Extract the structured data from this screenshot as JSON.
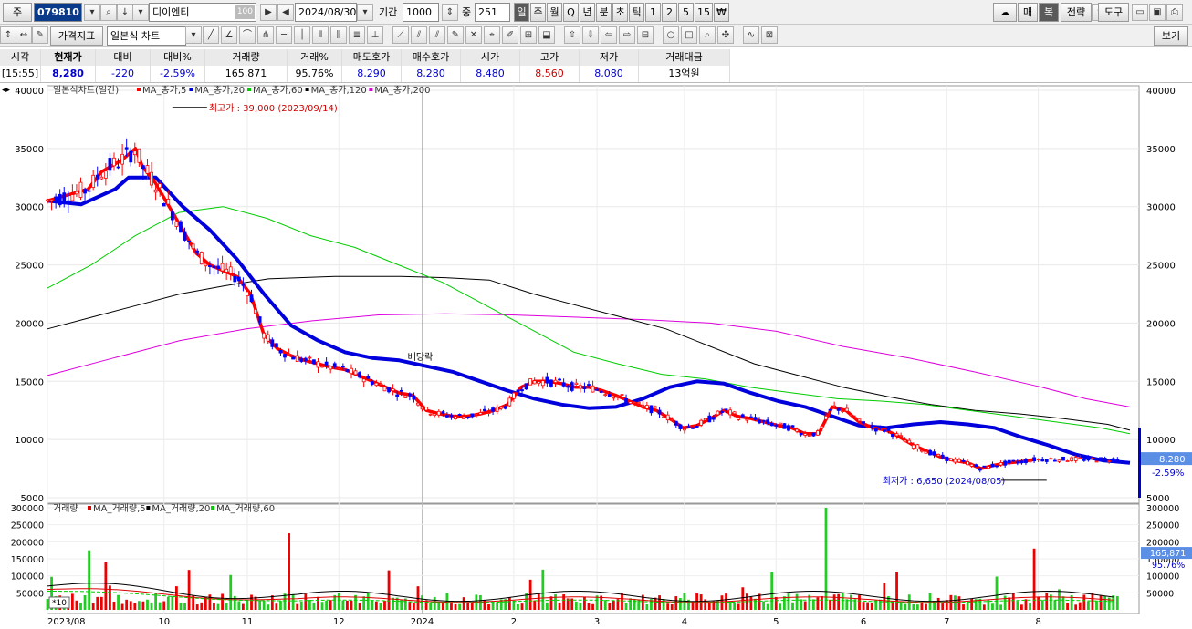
{
  "toolbar": {
    "mode_label": "주",
    "code": "079810",
    "name": "디이엔티",
    "name_badge": "100",
    "date": "2024/08/30",
    "period_label": "기간",
    "period_value": "1000",
    "mid_label": "중",
    "mid_value": "251",
    "timeframes": [
      "일",
      "주",
      "월",
      "Q",
      "년",
      "분",
      "초",
      "틱",
      "1",
      "2",
      "5",
      "15",
      "₩"
    ],
    "selected_timeframe": "일",
    "right_buttons": [
      "매",
      "복",
      "전략",
      "도구"
    ],
    "indicator_button": "가격지표",
    "chart_type": "일본식 차트",
    "view_button": "보기"
  },
  "quote": {
    "headers": [
      "시각",
      "현재가",
      "대비",
      "대비%",
      "거래량",
      "거래%",
      "매도호가",
      "매수호가",
      "시가",
      "고가",
      "저가",
      "거래대금"
    ],
    "values": [
      "[15:55]",
      "8,280",
      "-220",
      "-2.59%",
      "165,871",
      "95.76%",
      "8,290",
      "8,280",
      "8,480",
      "8,560",
      "8,080",
      "13억원"
    ]
  },
  "colors": {
    "ma5": "#ff0000",
    "ma20": "#0000dd",
    "ma60": "#00cc00",
    "ma120": "#000000",
    "ma200": "#dd00dd",
    "candle_up": "#ff0000",
    "candle_down": "#0000ff"
  },
  "chart_data": [
    {
      "type": "line",
      "legend_title": "일본식차트(일간)",
      "legend": [
        "MA_종가,5",
        "MA_종가,20",
        "MA_종가,60",
        "MA_종가,120",
        "MA_종가,200"
      ],
      "ylim": [
        5000,
        40000
      ],
      "yticks": [
        40000,
        35000,
        30000,
        25000,
        20000,
        15000,
        10000,
        5000
      ],
      "x_labels": [
        "2023/08",
        "10",
        "11",
        "12",
        "2024",
        "2",
        "3",
        "4",
        "5",
        "6",
        "7",
        "8"
      ],
      "x_label_index": [
        0,
        28,
        48,
        70,
        90,
        112,
        132,
        153,
        175,
        196,
        216,
        238
      ],
      "n_days": 260,
      "series": [
        {
          "name": "MA_종가,5",
          "values": [
            [
              0,
              30500
            ],
            [
              6,
              31000
            ],
            [
              12,
              31500
            ],
            [
              16,
              33000
            ],
            [
              22,
              34000
            ],
            [
              26,
              35000
            ],
            [
              28,
              33500
            ],
            [
              32,
              32000
            ],
            [
              36,
              30000
            ],
            [
              40,
              28000
            ],
            [
              44,
              26000
            ],
            [
              48,
              25000
            ],
            [
              52,
              24500
            ],
            [
              56,
              24000
            ],
            [
              60,
              22500
            ],
            [
              64,
              19000
            ],
            [
              68,
              17800
            ],
            [
              72,
              17200
            ],
            [
              76,
              16800
            ],
            [
              80,
              16500
            ],
            [
              84,
              16200
            ],
            [
              88,
              16000
            ],
            [
              92,
              15500
            ],
            [
              96,
              15000
            ],
            [
              100,
              14500
            ],
            [
              104,
              14000
            ],
            [
              108,
              13800
            ],
            [
              112,
              12500
            ],
            [
              116,
              12200
            ],
            [
              120,
              12000
            ],
            [
              124,
              12000
            ],
            [
              128,
              12200
            ],
            [
              132,
              12500
            ],
            [
              136,
              13000
            ],
            [
              140,
              14500
            ],
            [
              144,
              15000
            ],
            [
              148,
              15000
            ],
            [
              152,
              14800
            ],
            [
              156,
              14500
            ],
            [
              160,
              14500
            ],
            [
              164,
              14200
            ],
            [
              168,
              13800
            ],
            [
              172,
              13300
            ],
            [
              176,
              12800
            ],
            [
              180,
              12500
            ],
            [
              184,
              11800
            ],
            [
              188,
              11000
            ],
            [
              192,
              11200
            ],
            [
              196,
              11800
            ],
            [
              200,
              12500
            ],
            [
              204,
              12000
            ],
            [
              208,
              11800
            ],
            [
              212,
              11500
            ],
            [
              216,
              11200
            ],
            [
              220,
              11000
            ],
            [
              224,
              10500
            ],
            [
              228,
              10500
            ],
            [
              232,
              12800
            ],
            [
              236,
              12500
            ],
            [
              240,
              11500
            ],
            [
              244,
              11000
            ],
            [
              248,
              10800
            ],
            [
              252,
              10200
            ],
            [
              256,
              9500
            ],
            [
              260,
              9000
            ],
            [
              264,
              8500
            ],
            [
              268,
              8200
            ],
            [
              272,
              8000
            ],
            [
              276,
              7500
            ],
            [
              280,
              7800
            ],
            [
              284,
              8000
            ],
            [
              288,
              8100
            ],
            [
              292,
              8300
            ]
          ]
        },
        {
          "name": "MA_종가,20",
          "values": [
            [
              0,
              30500
            ],
            [
              10,
              30200
            ],
            [
              20,
              31500
            ],
            [
              24,
              32500
            ],
            [
              32,
              32500
            ],
            [
              40,
              30000
            ],
            [
              48,
              28000
            ],
            [
              56,
              25500
            ],
            [
              64,
              22500
            ],
            [
              72,
              19800
            ],
            [
              80,
              18500
            ],
            [
              88,
              17500
            ],
            [
              96,
              17000
            ],
            [
              104,
              16800
            ],
            [
              112,
              16300
            ],
            [
              120,
              15800
            ],
            [
              128,
              15000
            ],
            [
              136,
              14200
            ],
            [
              144,
              13500
            ],
            [
              152,
              13000
            ],
            [
              160,
              12700
            ],
            [
              168,
              12800
            ],
            [
              176,
              13500
            ],
            [
              184,
              14500
            ],
            [
              192,
              15000
            ],
            [
              200,
              14800
            ],
            [
              208,
              14000
            ],
            [
              216,
              13300
            ],
            [
              224,
              12800
            ],
            [
              232,
              12000
            ],
            [
              240,
              11200
            ],
            [
              248,
              11000
            ],
            [
              256,
              11300
            ],
            [
              264,
              11500
            ],
            [
              272,
              11300
            ],
            [
              280,
              11000
            ],
            [
              288,
              10200
            ],
            [
              296,
              9500
            ],
            [
              304,
              8700
            ],
            [
              312,
              8200
            ],
            [
              320,
              8000
            ]
          ]
        },
        {
          "name": "MA_종가,60",
          "values": [
            [
              0,
              23000
            ],
            [
              15,
              25000
            ],
            [
              30,
              27500
            ],
            [
              45,
              29500
            ],
            [
              60,
              30000
            ],
            [
              75,
              29000
            ],
            [
              90,
              27500
            ],
            [
              105,
              26500
            ],
            [
              120,
              25000
            ],
            [
              135,
              23500
            ],
            [
              150,
              21500
            ],
            [
              165,
              19500
            ],
            [
              180,
              17500
            ],
            [
              195,
              16500
            ],
            [
              210,
              15600
            ],
            [
              225,
              15200
            ],
            [
              240,
              14500
            ],
            [
              255,
              14000
            ],
            [
              270,
              13500
            ],
            [
              285,
              13300
            ],
            [
              300,
              13000
            ],
            [
              315,
              12500
            ],
            [
              330,
              12000
            ],
            [
              345,
              11500
            ],
            [
              360,
              11000
            ],
            [
              370,
              10500
            ]
          ]
        },
        {
          "name": "MA_종가,120",
          "values": [
            [
              0,
              19500
            ],
            [
              20,
              20500
            ],
            [
              40,
              21500
            ],
            [
              60,
              22500
            ],
            [
              80,
              23200
            ],
            [
              100,
              23800
            ],
            [
              130,
              24000
            ],
            [
              160,
              24000
            ],
            [
              180,
              23900
            ],
            [
              200,
              23700
            ],
            [
              220,
              22500
            ],
            [
              240,
              21500
            ],
            [
              260,
              20500
            ],
            [
              280,
              19500
            ],
            [
              300,
              18000
            ],
            [
              320,
              16500
            ],
            [
              340,
              15500
            ],
            [
              360,
              14500
            ],
            [
              380,
              13700
            ],
            [
              400,
              13000
            ],
            [
              420,
              12500
            ],
            [
              440,
              12200
            ],
            [
              460,
              11800
            ],
            [
              480,
              11300
            ],
            [
              490,
              10800
            ]
          ]
        },
        {
          "name": "MA_종가,200",
          "values": [
            [
              0,
              15500
            ],
            [
              30,
              17000
            ],
            [
              60,
              18500
            ],
            [
              90,
              19500
            ],
            [
              120,
              20200
            ],
            [
              150,
              20700
            ],
            [
              180,
              20800
            ],
            [
              210,
              20700
            ],
            [
              240,
              20500
            ],
            [
              270,
              20300
            ],
            [
              300,
              20000
            ],
            [
              330,
              19300
            ],
            [
              360,
              18000
            ],
            [
              390,
              17000
            ],
            [
              420,
              15800
            ],
            [
              450,
              14500
            ],
            [
              470,
              13500
            ],
            [
              490,
              12800
            ]
          ]
        }
      ],
      "annotations": [
        {
          "text": "최고가 : 39,000 (2023/09/14)",
          "x": 30,
          "y": 39000
        },
        {
          "text": "최저가 : 6,650 (2024/08/05)",
          "x": 240,
          "y": 6650
        },
        {
          "text": "배당락",
          "x": 92,
          "y": 16500
        }
      ],
      "last_price": "8,280",
      "last_change": "-2.59%"
    },
    {
      "type": "bar",
      "legend_title": "거래량",
      "legend": [
        "MA_거래량,5",
        "MA_거래량,20",
        "MA_거래량,60"
      ],
      "ylim": [
        0,
        300000
      ],
      "yticks": [
        300000,
        250000,
        200000,
        150000,
        100000,
        50000
      ],
      "scale_badge": "*10",
      "last_volume": "165,871",
      "last_volume_pct": "95.76%"
    }
  ]
}
